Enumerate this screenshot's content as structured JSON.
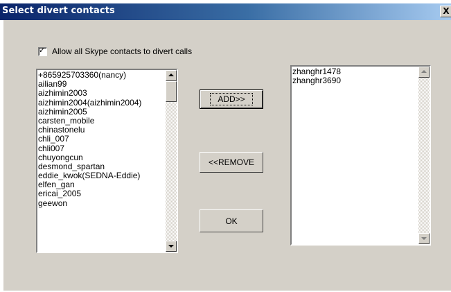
{
  "window": {
    "title": "Select divert contacts",
    "close_label": "X"
  },
  "checkbox": {
    "label": "Allow all Skype contacts to divert calls",
    "checked": true,
    "mark": "✓"
  },
  "left_list": {
    "items": [
      "+865925703360(nancy)",
      "ailian99",
      "aizhimin2003",
      "aizhimin2004(aizhimin2004)",
      "aizhimin2005",
      "carsten_mobile",
      "chinastonelu",
      "chli_007",
      "chli007",
      "chuyongcun",
      "desmond_spartan",
      "eddie_kwok(SEDNA-Eddie)",
      "elfen_gan",
      "ericai_2005",
      "geewon"
    ]
  },
  "right_list": {
    "items": [
      "zhanghr1478",
      "zhanghr3690"
    ]
  },
  "buttons": {
    "add": "ADD>>",
    "remove": "<<REMOVE",
    "ok": "OK"
  },
  "colors": {
    "title_gradient_start": "#0a246a",
    "title_gradient_end": "#a6caf0",
    "dialog_face": "#d4d0c8"
  }
}
